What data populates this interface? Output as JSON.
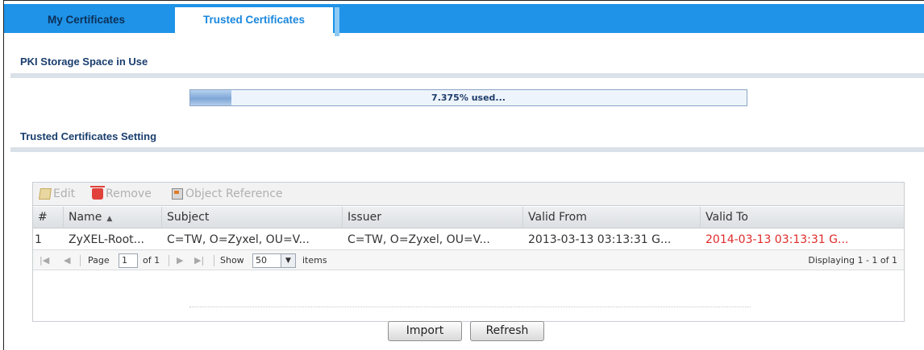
{
  "tabs": [
    {
      "label": "My Certificates",
      "active": false
    },
    {
      "label": "Trusted Certificates",
      "active": true
    }
  ],
  "storage": {
    "title": "PKI Storage Space in Use",
    "used_percent": 7.375,
    "text": "7.375% used..."
  },
  "setting": {
    "title": "Trusted Certificates Setting"
  },
  "toolbar": {
    "edit_label": "Edit",
    "remove_label": "Remove",
    "object_reference_label": "Object Reference"
  },
  "table": {
    "columns": [
      "#",
      "Name",
      "Subject",
      "Issuer",
      "Valid From",
      "Valid To"
    ],
    "sorted_column": "Name",
    "rows": [
      {
        "index": "1",
        "name": "ZyXEL-Root...",
        "subject": "C=TW, O=Zyxel, OU=V...",
        "issuer": "C=TW, O=Zyxel, OU=V...",
        "valid_from": "2013-03-13 03:13:31 G...",
        "valid_to": "2014-03-13 03:13:31 G..."
      }
    ]
  },
  "pager": {
    "page_label": "Page",
    "page_value": "1",
    "of_label": "of 1",
    "show_label": "Show",
    "show_value": "50",
    "items_label": "items",
    "displaying": "Displaying 1 - 1 of 1"
  },
  "buttons": {
    "import_label": "Import",
    "refresh_label": "Refresh"
  },
  "colors": {
    "tab_bar": "#1e93e8",
    "section_title": "#1a3e6e",
    "expired_text": "#e02a2a"
  }
}
